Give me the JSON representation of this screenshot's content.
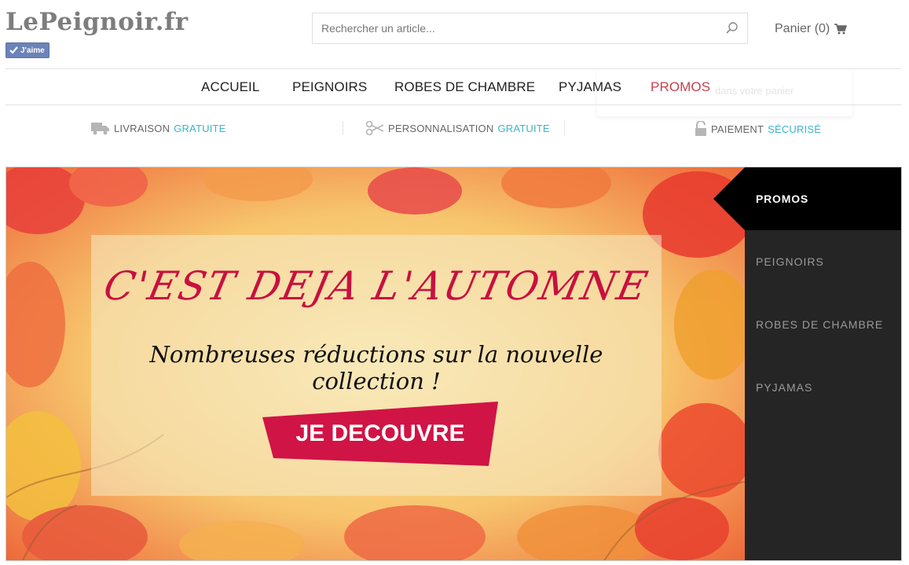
{
  "header": {
    "logo": "LePeignoir.fr",
    "like_label": "J'aime",
    "search_placeholder": "Rechercher un article...",
    "cart_label": "Panier (0)",
    "cart_dropdown_text": "dans votre panier"
  },
  "nav": {
    "items": [
      {
        "label": "ACCUEIL"
      },
      {
        "label": "PEIGNOIRS"
      },
      {
        "label": "ROBES DE CHAMBRE"
      },
      {
        "label": "PYJAMAS"
      },
      {
        "label": "PROMOS"
      }
    ],
    "promo_color": "#c8414d"
  },
  "features": [
    {
      "label": "LIVRAISON",
      "highlight": "GRATUITE",
      "icon": "truck-icon"
    },
    {
      "label": "PERSONNALISATION",
      "highlight": "GRATUITE",
      "icon": "scissors-icon"
    },
    {
      "label": "PAIEMENT",
      "highlight": "SÉCURISÉ",
      "icon": "lock-icon"
    }
  ],
  "banner": {
    "headline": "C'EST DEJA L'AUTOMNE",
    "subline": "Nombreuses réductions sur la nouvelle collection !",
    "cta_label": "JE DECOUVRE",
    "cta_color": "#d01446",
    "side_menu": [
      {
        "label": "PROMOS",
        "active": true
      },
      {
        "label": "PEIGNOIRS"
      },
      {
        "label": "ROBES DE CHAMBRE"
      },
      {
        "label": "PYJAMAS"
      }
    ]
  },
  "colors": {
    "accent": "#3bb4c8",
    "headline": "#c8103f",
    "sidebar_bg": "#252525"
  }
}
